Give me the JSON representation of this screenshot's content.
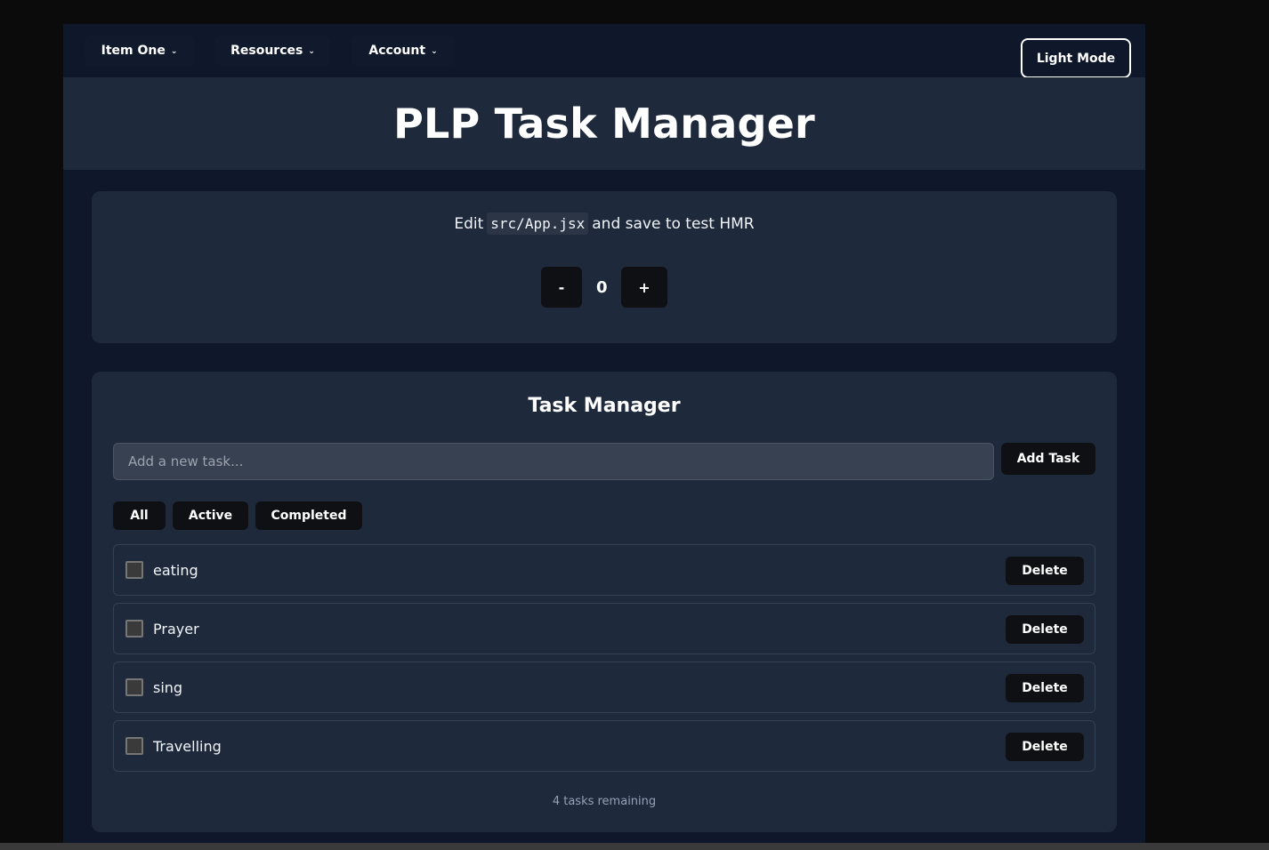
{
  "nav": {
    "items": [
      {
        "label": "Item One"
      },
      {
        "label": "Resources"
      },
      {
        "label": "Account"
      }
    ],
    "theme_toggle": "Light Mode"
  },
  "header": {
    "title": "PLP Task Manager"
  },
  "hmr": {
    "prefix": "Edit",
    "file": "src/App.jsx",
    "suffix": "and save to test HMR"
  },
  "counter": {
    "decrement": "-",
    "value": "0",
    "increment": "+"
  },
  "task_manager": {
    "title": "Task Manager",
    "input_placeholder": "Add a new task...",
    "add_button": "Add Task",
    "filters": [
      "All",
      "Active",
      "Completed"
    ],
    "tasks": [
      {
        "text": "eating",
        "completed": false
      },
      {
        "text": "Prayer",
        "completed": false
      },
      {
        "text": "sing",
        "completed": false
      },
      {
        "text": "Travelling",
        "completed": false
      }
    ],
    "delete_label": "Delete",
    "remaining": "4 tasks remaining"
  }
}
